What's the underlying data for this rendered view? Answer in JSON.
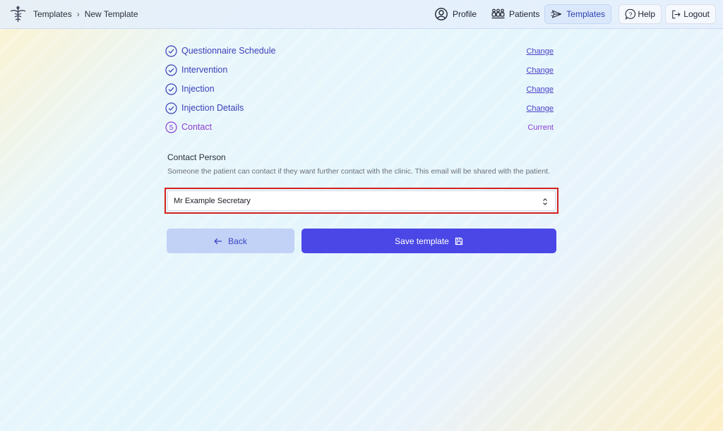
{
  "breadcrumb": {
    "root": "Templates",
    "separator": "›",
    "current": "New Template"
  },
  "nav": {
    "profile": {
      "label": "Profile",
      "icon": "user-circle-icon"
    },
    "patients": {
      "label": "Patients",
      "icon": "people-group-icon"
    },
    "templates": {
      "label": "Templates",
      "icon": "send-arrow-icon"
    },
    "help": {
      "label": "Help",
      "icon": "help-bubble-icon"
    },
    "logout": {
      "label": "Logout",
      "icon": "logout-door-icon"
    }
  },
  "steps": [
    {
      "label": "Questionnaire Schedule",
      "action": "Change",
      "status": "complete"
    },
    {
      "label": "Intervention",
      "action": "Change",
      "status": "complete"
    },
    {
      "label": "Injection",
      "action": "Change",
      "status": "complete"
    },
    {
      "label": "Injection Details",
      "action": "Change",
      "status": "complete"
    },
    {
      "label": "Contact",
      "action": "Current",
      "status": "current",
      "number": "5"
    }
  ],
  "contact": {
    "title": "Contact Person",
    "description": "Someone the patient can contact if they want further contact with the clinic. This email will be shared with the patient.",
    "selected": "Mr Example Secretary"
  },
  "buttons": {
    "back": "Back",
    "save": "Save template"
  },
  "colors": {
    "primary": "#4a47e6",
    "secondary": "#c2d1f6",
    "highlight": "#d62020",
    "current_step": "#8a3fd0"
  }
}
